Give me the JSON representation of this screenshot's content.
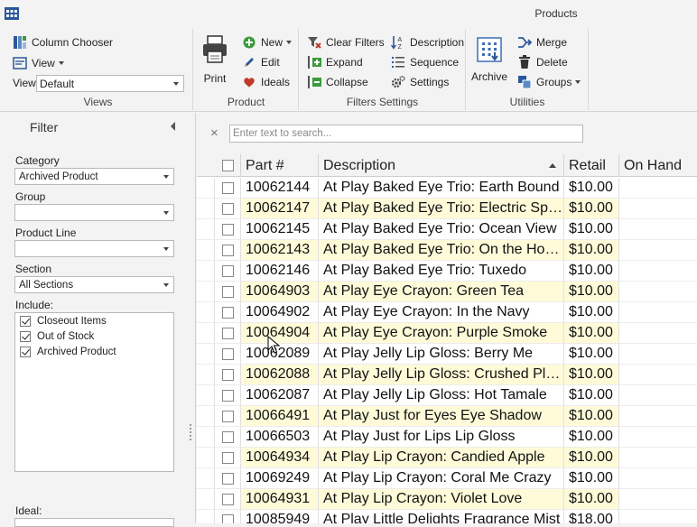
{
  "window": {
    "title": "Products"
  },
  "ribbon": {
    "views": {
      "label": "Views",
      "column_chooser": "Column Chooser",
      "view_menu": "View",
      "view_field_label": "View",
      "view_value": "Default"
    },
    "product": {
      "label": "Product",
      "print": "Print",
      "new": "New",
      "edit": "Edit",
      "ideals": "Ideals"
    },
    "filters_settings": {
      "label": "Filters  Settings",
      "clear_filters": "Clear Filters",
      "expand": "Expand",
      "collapse": "Collapse",
      "description": "Description",
      "sequence": "Sequence",
      "settings": "Settings"
    },
    "utilities": {
      "label": "Utilities",
      "archive": "Archive",
      "merge": "Merge",
      "delete": "Delete",
      "groups": "Groups"
    }
  },
  "filter": {
    "title": "Filter",
    "category_label": "Category",
    "category_value": "Archived Product",
    "group_label": "Group",
    "group_value": "",
    "product_line_label": "Product Line",
    "product_line_value": "",
    "section_label": "Section",
    "section_value": "All Sections",
    "include_label": "Include:",
    "include_items": [
      {
        "label": "Closeout Items",
        "checked": true
      },
      {
        "label": "Out of Stock",
        "checked": true
      },
      {
        "label": "Archived Product",
        "checked": true
      }
    ],
    "ideal_label": "Ideal:"
  },
  "search": {
    "placeholder": "Enter text to search..."
  },
  "grid": {
    "columns": [
      "Part #",
      "Description",
      "Retail",
      "On Hand"
    ],
    "rows": [
      {
        "part": "10062144",
        "desc": "At Play Baked Eye Trio: Earth Bound",
        "retail": "$10.00",
        "onhand": ""
      },
      {
        "part": "10062147",
        "desc": "At Play Baked Eye Trio: Electric Spring",
        "retail": "$10.00",
        "onhand": ""
      },
      {
        "part": "10062145",
        "desc": "At Play Baked Eye Trio: Ocean View",
        "retail": "$10.00",
        "onhand": ""
      },
      {
        "part": "10062143",
        "desc": "At Play Baked Eye Trio: On the Horizon",
        "retail": "$10.00",
        "onhand": ""
      },
      {
        "part": "10062146",
        "desc": "At Play Baked Eye Trio: Tuxedo",
        "retail": "$10.00",
        "onhand": ""
      },
      {
        "part": "10064903",
        "desc": "At Play Eye Crayon: Green Tea",
        "retail": "$10.00",
        "onhand": ""
      },
      {
        "part": "10064902",
        "desc": "At Play Eye Crayon: In the Navy",
        "retail": "$10.00",
        "onhand": ""
      },
      {
        "part": "10064904",
        "desc": "At Play Eye Crayon: Purple Smoke",
        "retail": "$10.00",
        "onhand": ""
      },
      {
        "part": "10062089",
        "desc": "At Play Jelly Lip Gloss: Berry Me",
        "retail": "$10.00",
        "onhand": ""
      },
      {
        "part": "10062088",
        "desc": "At Play Jelly Lip Gloss: Crushed Plum",
        "retail": "$10.00",
        "onhand": ""
      },
      {
        "part": "10062087",
        "desc": "At Play Jelly Lip Gloss: Hot Tamale",
        "retail": "$10.00",
        "onhand": ""
      },
      {
        "part": "10066491",
        "desc": "At Play Just for Eyes Eye Shadow",
        "retail": "$10.00",
        "onhand": ""
      },
      {
        "part": "10066503",
        "desc": "At Play Just for Lips Lip Gloss",
        "retail": "$10.00",
        "onhand": ""
      },
      {
        "part": "10064934",
        "desc": "At Play Lip Crayon: Candied Apple",
        "retail": "$10.00",
        "onhand": ""
      },
      {
        "part": "10069249",
        "desc": "At Play Lip Crayon: Coral Me Crazy",
        "retail": "$10.00",
        "onhand": ""
      },
      {
        "part": "10064931",
        "desc": "At Play Lip Crayon: Violet Love",
        "retail": "$10.00",
        "onhand": ""
      },
      {
        "part": "10085949",
        "desc": "At Play Little Delights Fragrance Mist",
        "retail": "$18.00",
        "onhand": ""
      }
    ]
  },
  "colors": {
    "alt_row": "#fffbd9",
    "accent": "#2b579a"
  }
}
